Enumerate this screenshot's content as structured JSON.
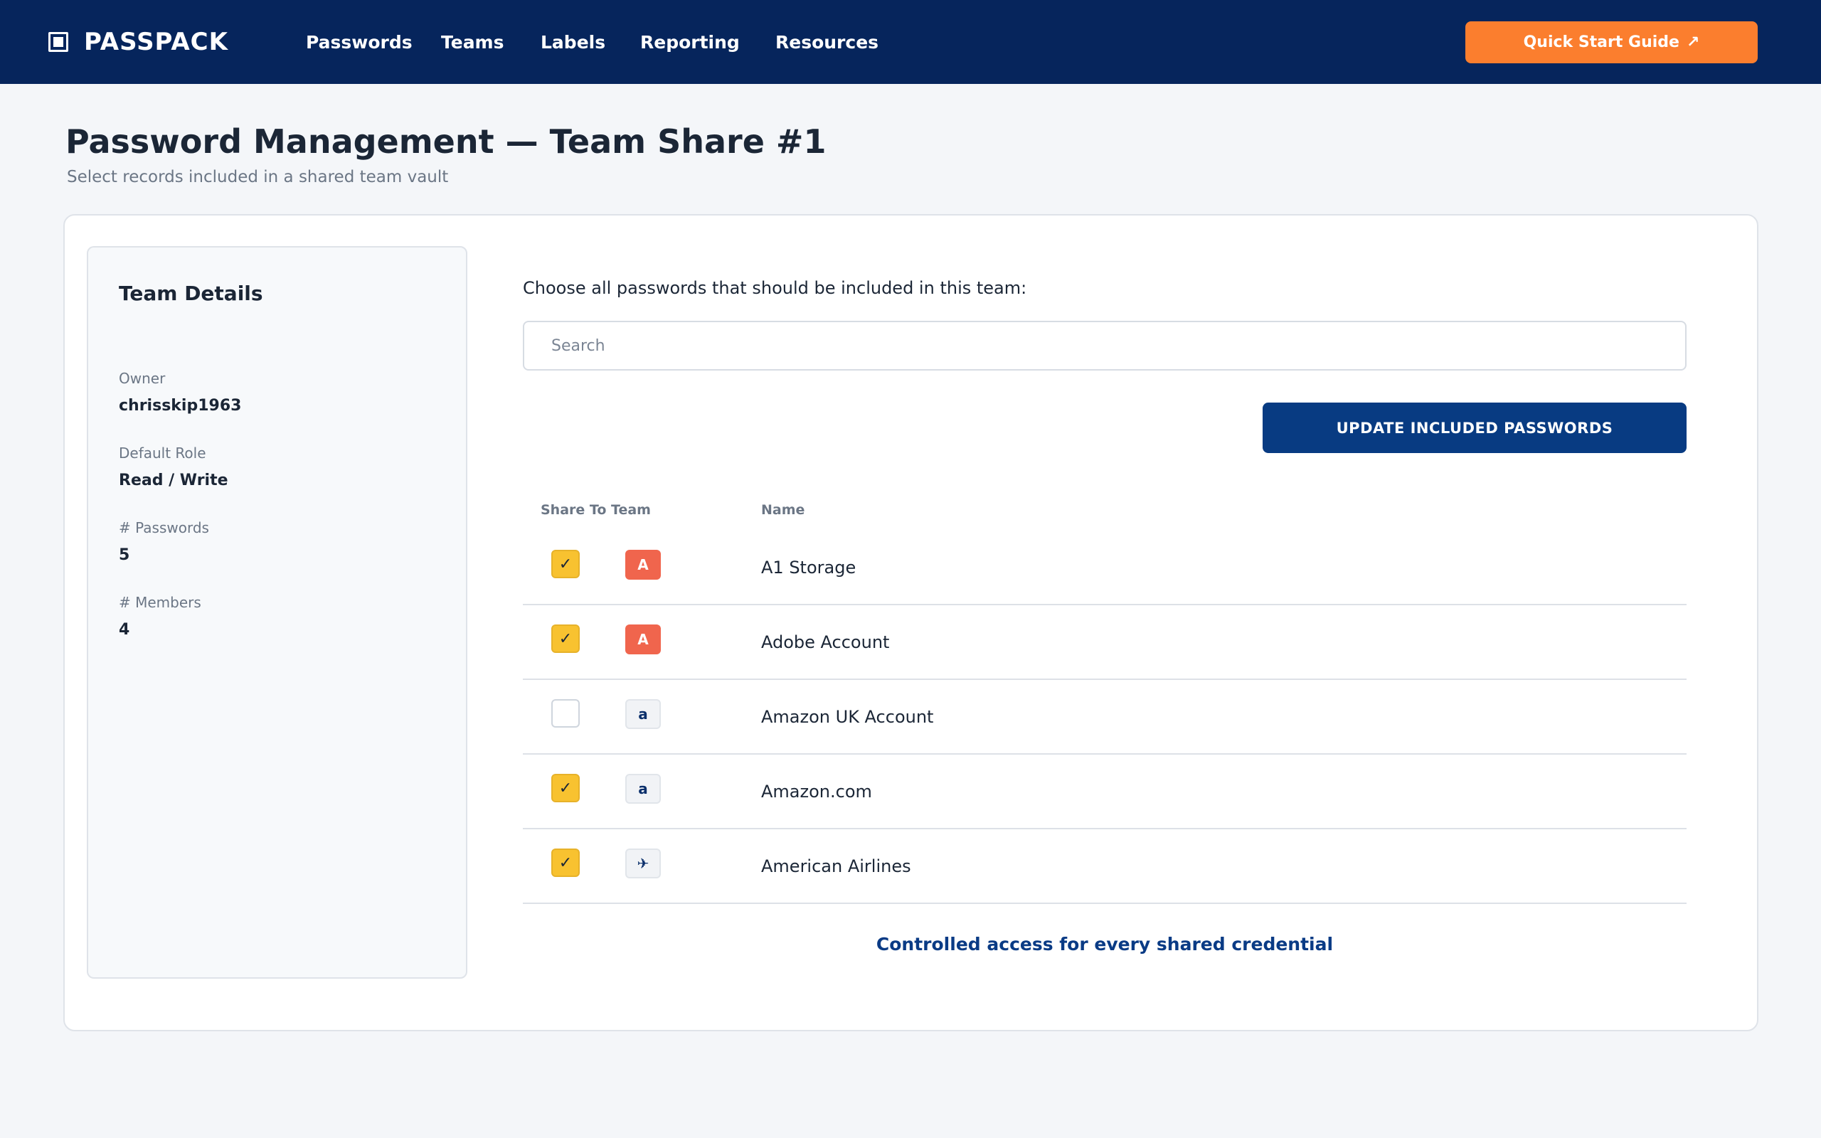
{
  "header": {
    "brand": "PASSPACK",
    "nav": [
      "Passwords",
      "Teams",
      "Labels",
      "Reporting",
      "Resources"
    ],
    "cta_label": "Quick Start Guide",
    "cta_icon": "↗"
  },
  "page": {
    "title": "Password Management — Team Share #1",
    "subtitle": "Select records included in a shared team vault"
  },
  "team_details": {
    "title": "Team Details",
    "owner_label": "Owner",
    "owner_value": "chrisskip1963",
    "role_label": "Default Role",
    "role_value": "Read / Write",
    "passwords_label": "# Passwords",
    "passwords_value": "5",
    "members_label": "# Members",
    "members_value": "4"
  },
  "selection": {
    "instructions": "Choose all passwords that should be included in this team:",
    "search_placeholder": "Search",
    "update_button": "UPDATE INCLUDED PASSWORDS",
    "col_share": "Share To Team",
    "col_name": "Name",
    "rows": [
      {
        "name": "A1 Storage",
        "checked": true,
        "icon_text": "A",
        "icon_name": "a1-storage-icon"
      },
      {
        "name": "Adobe Account",
        "checked": true,
        "icon_text": "A",
        "icon_name": "adobe-icon"
      },
      {
        "name": "Amazon UK Account",
        "checked": false,
        "icon_text": "a",
        "icon_name": "amazon-icon"
      },
      {
        "name": "Amazon.com",
        "checked": true,
        "icon_text": "a",
        "icon_name": "amazon-icon"
      },
      {
        "name": "American Airlines",
        "checked": true,
        "icon_text": "✈",
        "icon_name": "airplane-icon"
      }
    ],
    "check_glyph": "✓",
    "tagline": "Controlled access for every shared credential"
  },
  "colors": {
    "header_bg": "#06255c",
    "cta_bg": "#fb7e2e",
    "primary_button": "#083b82",
    "checkbox_checked": "#f8c230",
    "favicon_red": "#f0654d",
    "favicon_light": "#f1f3f6"
  }
}
